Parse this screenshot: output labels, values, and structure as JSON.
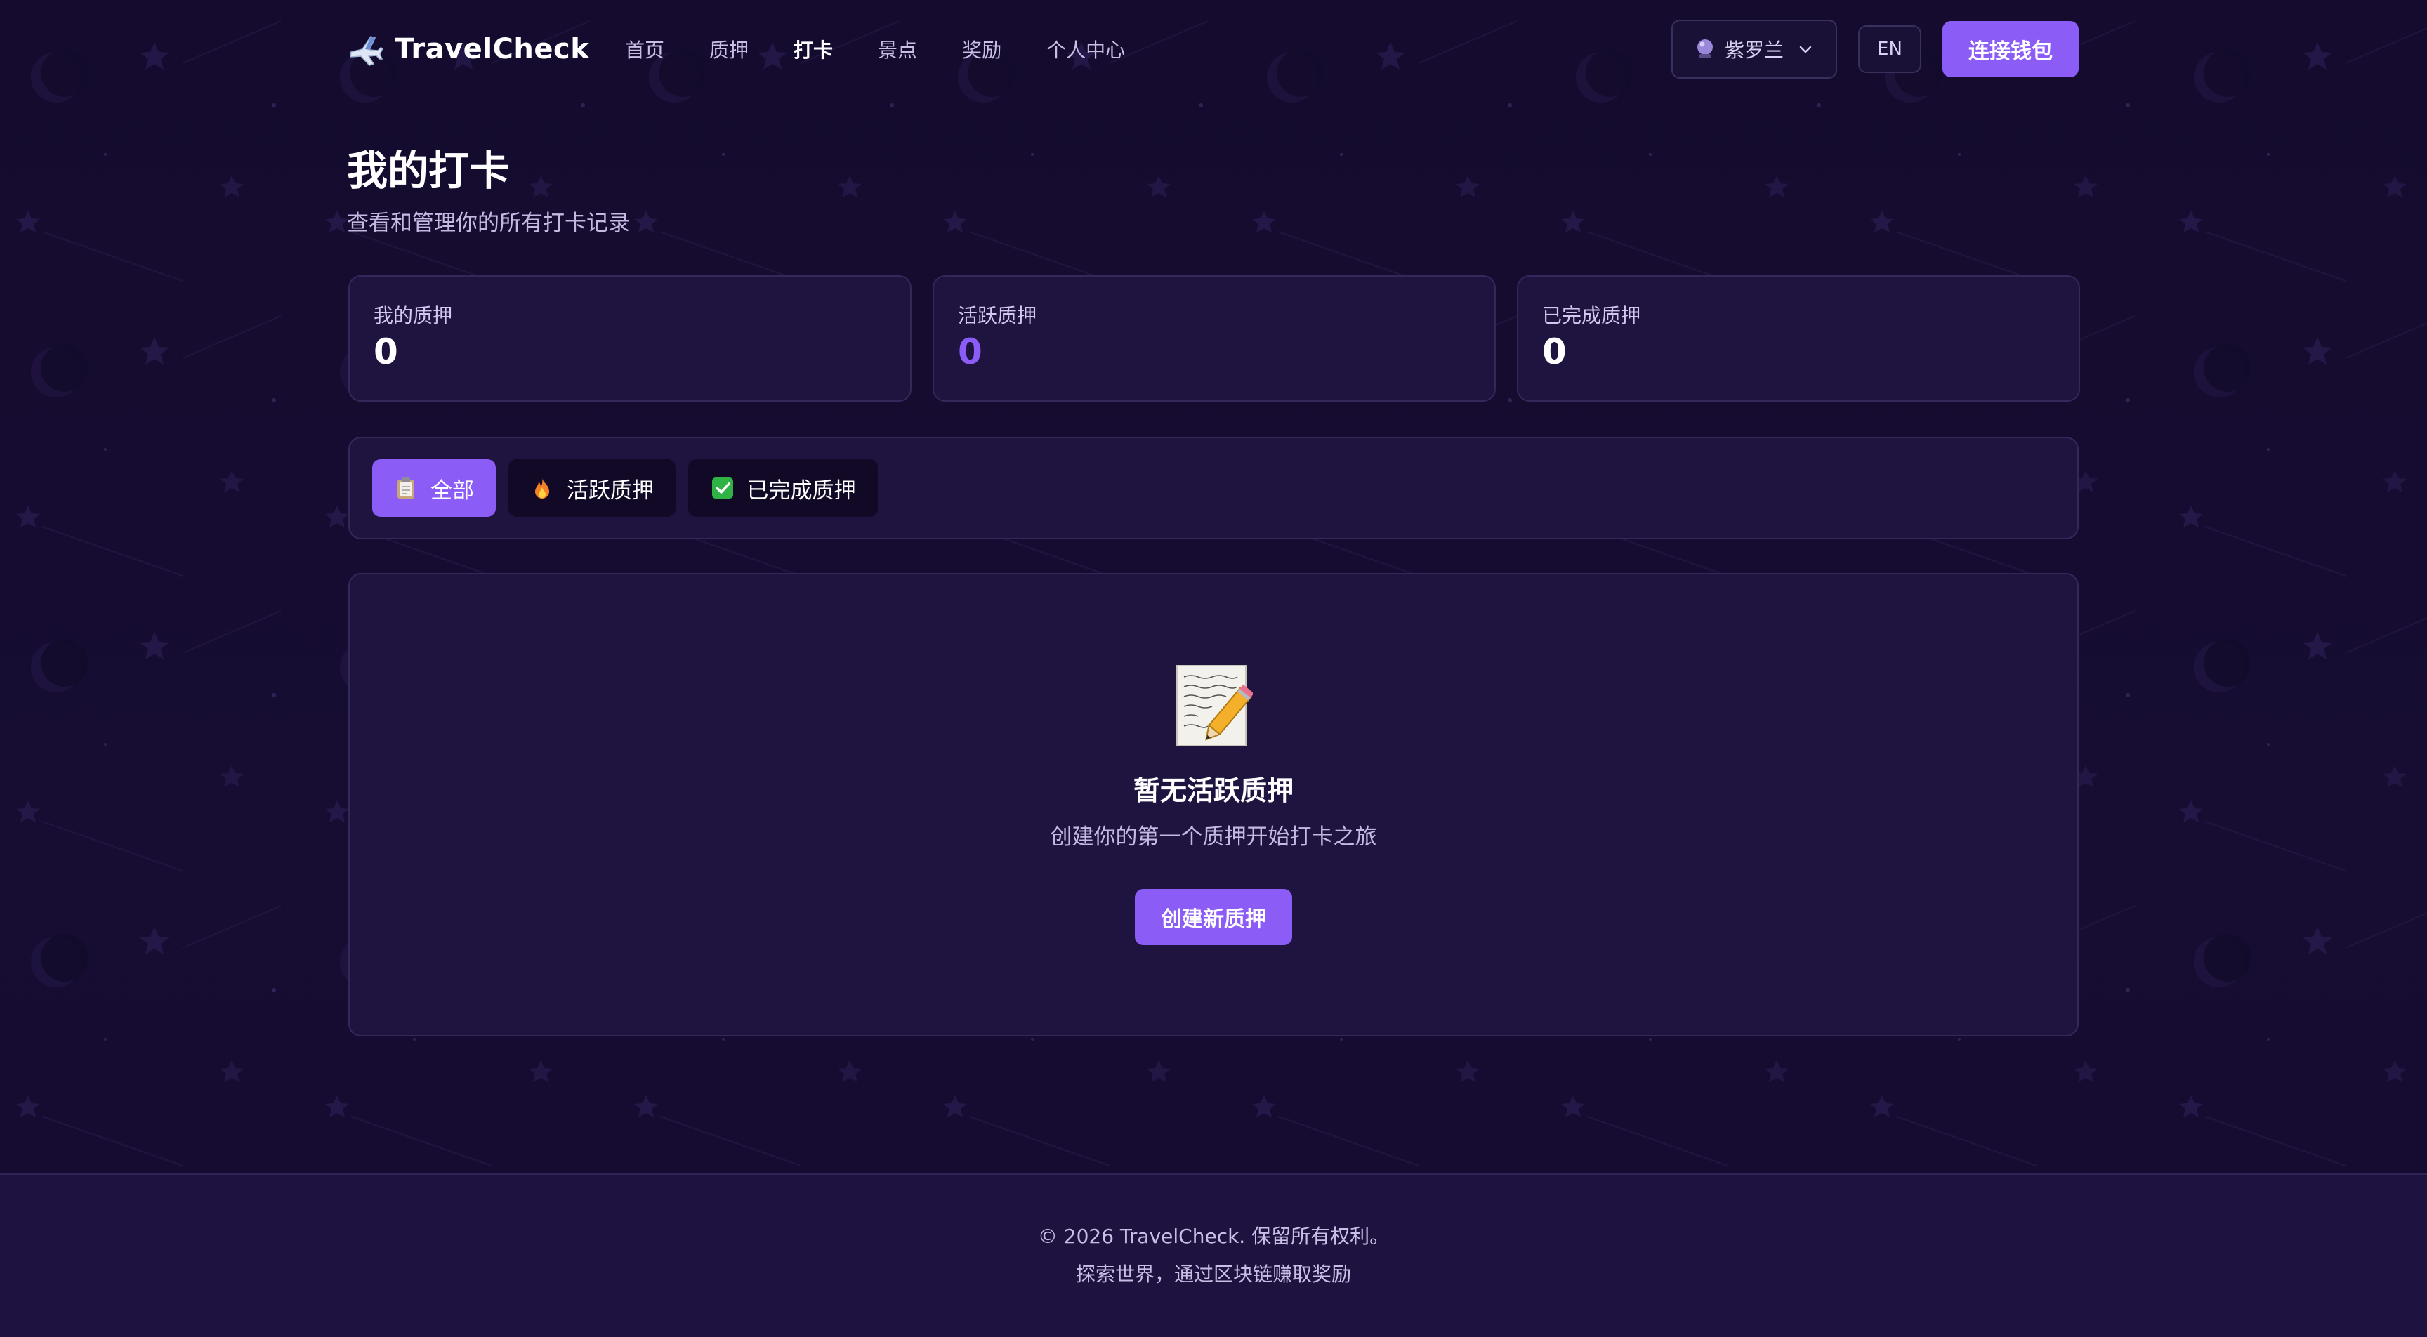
{
  "brand": {
    "name": "TravelCheck",
    "icon": "airplane-icon"
  },
  "nav": {
    "items": [
      {
        "label": "首页",
        "active": false
      },
      {
        "label": "质押",
        "active": false
      },
      {
        "label": "打卡",
        "active": true
      },
      {
        "label": "景点",
        "active": false
      },
      {
        "label": "奖励",
        "active": false
      },
      {
        "label": "个人中心",
        "active": false
      }
    ]
  },
  "theme_select": {
    "label": "紫罗兰",
    "icon": "crystal-ball-icon"
  },
  "lang_button": {
    "label": "EN"
  },
  "wallet_button": {
    "label": "连接钱包"
  },
  "header": {
    "title": "我的打卡",
    "subtitle": "查看和管理你的所有打卡记录"
  },
  "stats": [
    {
      "label": "我的质押",
      "value": "0"
    },
    {
      "label": "活跃质押",
      "value": "0"
    },
    {
      "label": "已完成质押",
      "value": "0"
    }
  ],
  "tabs": [
    {
      "label": "全部",
      "icon": "clipboard-icon",
      "active": true
    },
    {
      "label": "活跃质押",
      "icon": "fire-icon",
      "active": false
    },
    {
      "label": "已完成质押",
      "icon": "check-mark-icon",
      "active": false
    }
  ],
  "empty_state": {
    "icon": "memo-icon",
    "title": "暂无活跃质押",
    "description": "创建你的第一个质押开始打卡之旅",
    "button_label": "创建新质押"
  },
  "footer": {
    "copyright": "© 2026 TravelCheck. 保留所有权利。",
    "tagline": "探索世界，通过区块链赚取奖励"
  },
  "colors": {
    "background": "#130b2b",
    "panel": "#1f1340",
    "accent": "#8b5cf6",
    "footer": "#1e1240"
  }
}
